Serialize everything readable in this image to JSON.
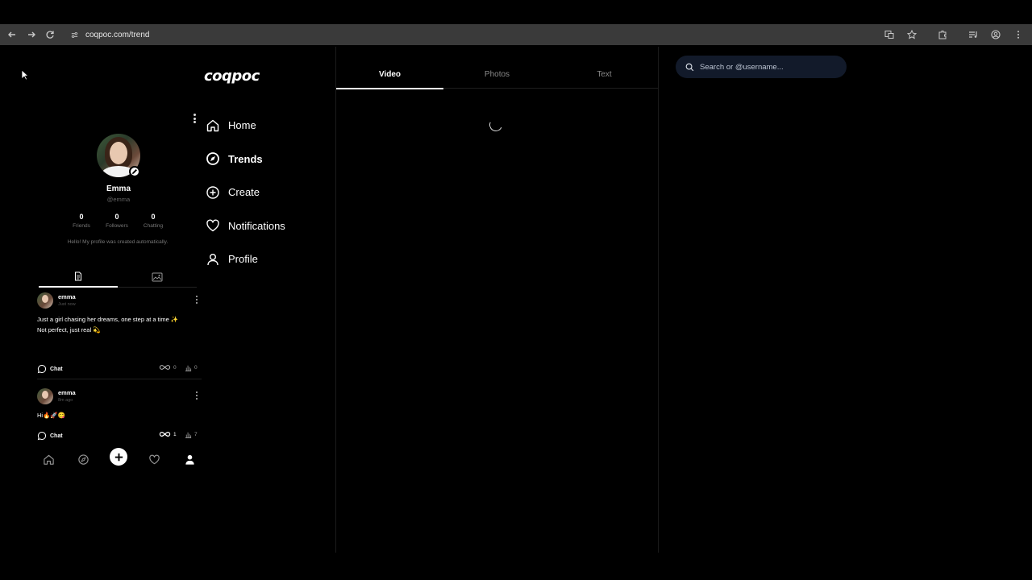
{
  "browser": {
    "url": "coqpoc.com/trend"
  },
  "app": {
    "logo": "coqpoc"
  },
  "nav": {
    "items": [
      {
        "label": "Home",
        "icon": "home-icon"
      },
      {
        "label": "Trends",
        "icon": "compass-icon"
      },
      {
        "label": "Create",
        "icon": "plus-circle-icon"
      },
      {
        "label": "Notifications",
        "icon": "heart-icon"
      },
      {
        "label": "Profile",
        "icon": "user-icon"
      }
    ],
    "active": "Trends"
  },
  "profile": {
    "name": "Emma",
    "handle": "@emma",
    "stats": [
      {
        "value": "0",
        "label": "Friends"
      },
      {
        "value": "0",
        "label": "Followers"
      },
      {
        "value": "0",
        "label": "Chatting"
      }
    ],
    "bio": "Hello! My profile was created automatically."
  },
  "posts": [
    {
      "author": "emma",
      "time": "Just now",
      "text_line1": "Just a girl chasing her dreams, one step at a time ✨",
      "text_line2": "Not perfect, just real 💫",
      "chat_label": "Chat",
      "links": "0",
      "views": "0"
    },
    {
      "author": "emma",
      "time": "8m ago",
      "text_line1": "Hi🔥🚀😋",
      "chat_label": "Chat",
      "links": "1",
      "views": "7"
    }
  ],
  "feed": {
    "tabs": [
      "Video",
      "Photos",
      "Text"
    ],
    "active_tab": "Video"
  },
  "search": {
    "placeholder": "Search or @username..."
  },
  "colors": {
    "background": "#000000",
    "search_bg": "#121a2a",
    "chrome_bar": "#3a3a3a"
  }
}
